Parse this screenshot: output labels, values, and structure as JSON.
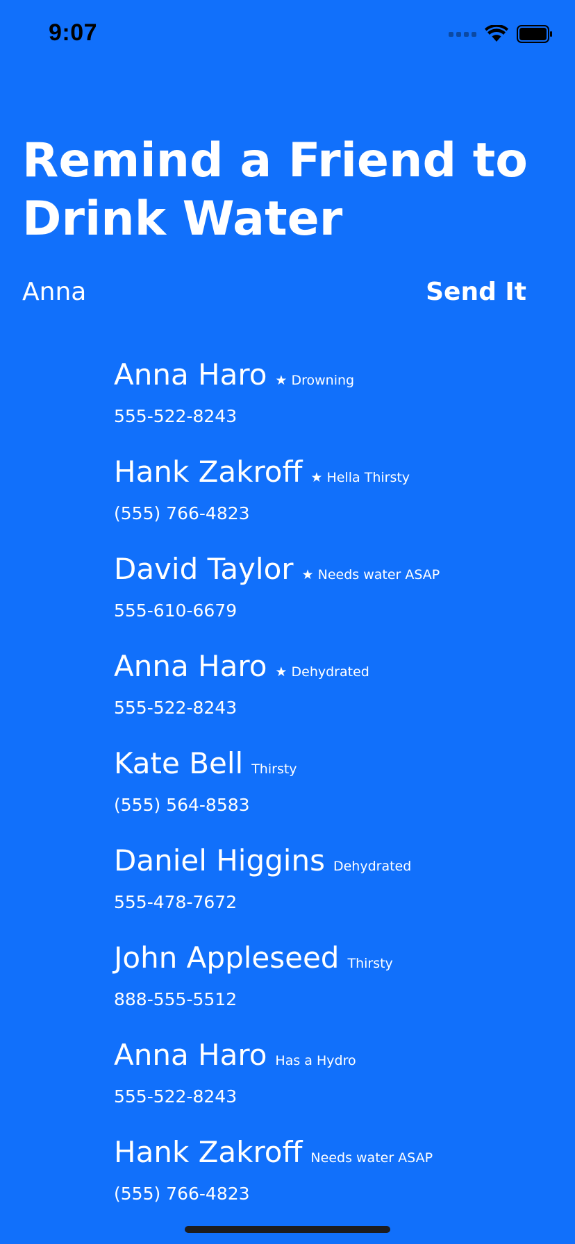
{
  "status_bar": {
    "time": "9:07",
    "icons": [
      "cellular-signal-icon",
      "wifi-icon",
      "battery-icon"
    ]
  },
  "header": {
    "title": "Remind a Friend to Drink Water"
  },
  "search": {
    "value": "Anna"
  },
  "send_button": {
    "label": "Send It"
  },
  "friends": [
    {
      "name": "Anna Haro",
      "status": "★ Drowning",
      "phone": "555-522-8243"
    },
    {
      "name": "Hank Zakroff",
      "status": "★ Hella Thirsty",
      "phone": "(555) 766-4823"
    },
    {
      "name": "David Taylor",
      "status": "★ Needs water ASAP",
      "phone": "555-610-6679"
    },
    {
      "name": "Anna Haro",
      "status": "★ Dehydrated",
      "phone": "555-522-8243"
    },
    {
      "name": "Kate Bell",
      "status": "Thirsty",
      "phone": "(555) 564-8583"
    },
    {
      "name": "Daniel Higgins",
      "status": "Dehydrated",
      "phone": "555-478-7672"
    },
    {
      "name": "John Appleseed",
      "status": "Thirsty",
      "phone": "888-555-5512"
    },
    {
      "name": "Anna Haro",
      "status": "Has a Hydro",
      "phone": "555-522-8243"
    },
    {
      "name": "Hank Zakroff",
      "status": "Needs water ASAP",
      "phone": "(555) 766-4823"
    }
  ],
  "colors": {
    "background": "#1170fb",
    "text": "#ffffff",
    "status_text": "#000000"
  }
}
